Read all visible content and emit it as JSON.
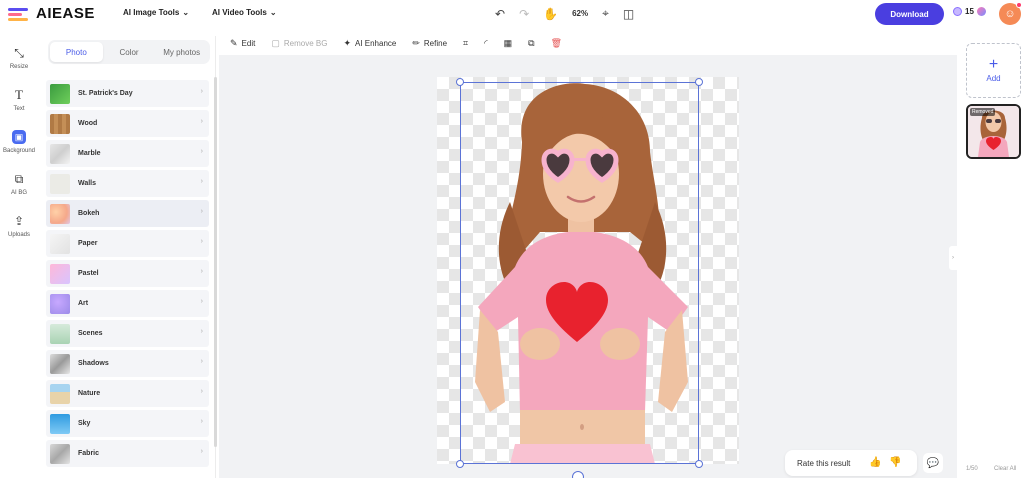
{
  "header": {
    "brand": "AIEASE",
    "menus": [
      {
        "label": "AI Image Tools"
      },
      {
        "label": "AI Video Tools"
      }
    ],
    "zoom": "62%",
    "download_label": "Download",
    "credits": "15"
  },
  "rail": [
    {
      "label": "Resize",
      "icon": "resize-icon"
    },
    {
      "label": "Text",
      "icon": "text-icon"
    },
    {
      "label": "Background",
      "icon": "background-icon",
      "active": true
    },
    {
      "label": "AI BG",
      "icon": "ai-bg-icon"
    },
    {
      "label": "Uploads",
      "icon": "upload-icon"
    }
  ],
  "panel": {
    "tabs": [
      "Photo",
      "Color",
      "My photos"
    ],
    "active_tab": "Photo",
    "items": [
      {
        "label": "St. Patrick's Day"
      },
      {
        "label": "Wood"
      },
      {
        "label": "Marble"
      },
      {
        "label": "Walls"
      },
      {
        "label": "Bokeh"
      },
      {
        "label": "Paper"
      },
      {
        "label": "Pastel"
      },
      {
        "label": "Art"
      },
      {
        "label": "Scenes"
      },
      {
        "label": "Shadows"
      },
      {
        "label": "Nature"
      },
      {
        "label": "Sky"
      },
      {
        "label": "Fabric"
      }
    ]
  },
  "toolbar": {
    "edit": "Edit",
    "remove_bg": "Remove BG",
    "ai_enhance": "AI Enhance",
    "refine": "Refine"
  },
  "feedback": {
    "rate_label": "Rate this result"
  },
  "right_panel": {
    "add_label": "Add",
    "thumb_tag": "Removed",
    "pager": "1/50",
    "clear_all": "Clear All"
  },
  "colors": {
    "accent": "#4a3ee0",
    "selection": "#5b73d6",
    "shirt": "#f4a7bd",
    "heart": "#e8222e"
  }
}
